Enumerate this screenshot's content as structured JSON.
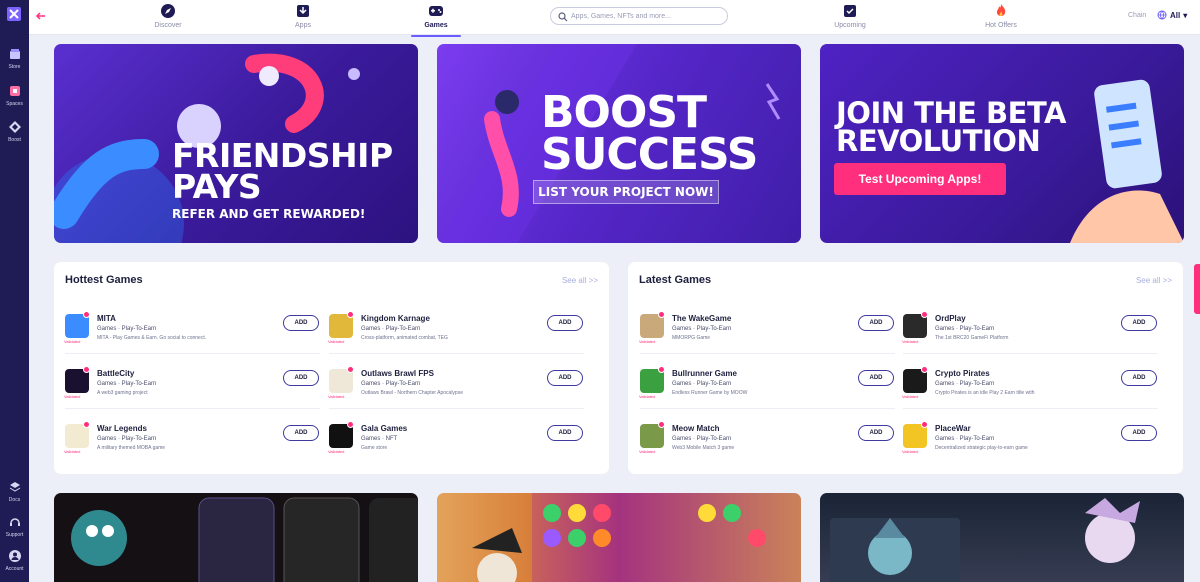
{
  "sidebar": {
    "items": [
      {
        "label": "Store"
      },
      {
        "label": "Spaces"
      },
      {
        "label": "Boost"
      }
    ],
    "bottom_items": [
      {
        "label": "Docs"
      },
      {
        "label": "Support"
      },
      {
        "label": "Account"
      }
    ]
  },
  "topnav": {
    "tabs": [
      {
        "label": "Discover"
      },
      {
        "label": "Apps"
      },
      {
        "label": "Games"
      },
      {
        "label": "Upcoming"
      },
      {
        "label": "Hot Offers"
      }
    ],
    "active_tab": "Games",
    "search_placeholder": "Apps, Games, NFTs and more...",
    "chain_label": "Chain",
    "chain_value": "All"
  },
  "banners": {
    "friendship": {
      "title_line1": "FRIENDSHIP",
      "title_line2": "PAYS",
      "subtitle": "REFER AND GET REWARDED!"
    },
    "boost": {
      "title_line1": "BOOST",
      "title_line2": "SUCCESS",
      "cta": "LIST YOUR PROJECT NOW!"
    },
    "beta": {
      "title_line1": "JOIN THE BETA",
      "title_line2": "REVOLUTION",
      "cta": "Test Upcoming Apps!"
    }
  },
  "hottest": {
    "title": "Hottest Games",
    "see_all": "See all >>",
    "add_label": "ADD",
    "verified_label": "Validated",
    "games": [
      {
        "name": "MITA",
        "category": "Games · Play-To-Earn",
        "desc": "MITA - Play Games & Earn. Go social to connect."
      },
      {
        "name": "BattleCity",
        "category": "Games · Play-To-Earn",
        "desc": "A web3 gaming project"
      },
      {
        "name": "War Legends",
        "category": "Games · Play-To-Earn",
        "desc": "A military themed MOBA game"
      },
      {
        "name": "Kingdom Karnage",
        "category": "Games · Play-To-Earn",
        "desc": "Cross-platform, animated combat, TEG"
      },
      {
        "name": "Outlaws Brawl FPS",
        "category": "Games · Play-To-Earn",
        "desc": "Outlaws Brawl - Northern Chapter Apocalypse"
      },
      {
        "name": "Gala Games",
        "category": "Games · NFT",
        "desc": "Game store"
      }
    ]
  },
  "latest": {
    "title": "Latest Games",
    "see_all": "See all >>",
    "add_label": "ADD",
    "verified_label": "Validated",
    "games": [
      {
        "name": "The WakeGame",
        "category": "Games · Play-To-Earn",
        "desc": "MMORPG Game"
      },
      {
        "name": "Bullrunner Game",
        "category": "Games · Play-To-Earn",
        "desc": "Endless Runner Game by MOOW"
      },
      {
        "name": "Meow Match",
        "category": "Games · Play-To-Earn",
        "desc": "Web3 Mobile Match 3 game"
      },
      {
        "name": "OrdPlay",
        "category": "Games · Play-To-Earn",
        "desc": "The 1st BRC20 GameFi Platform"
      },
      {
        "name": "Crypto Pirates",
        "category": "Games · Play-To-Earn",
        "desc": "Crypto Pirates is an idle Play 2 Earn title with"
      },
      {
        "name": "PlaceWar",
        "category": "Games · Play-To-Earn",
        "desc": "Decentralized strategic play-to-earn game"
      }
    ]
  },
  "colors": {
    "accent": "#ff2f7d",
    "nav_dark": "#1e1b55",
    "primary_purple": "#5526c8"
  }
}
